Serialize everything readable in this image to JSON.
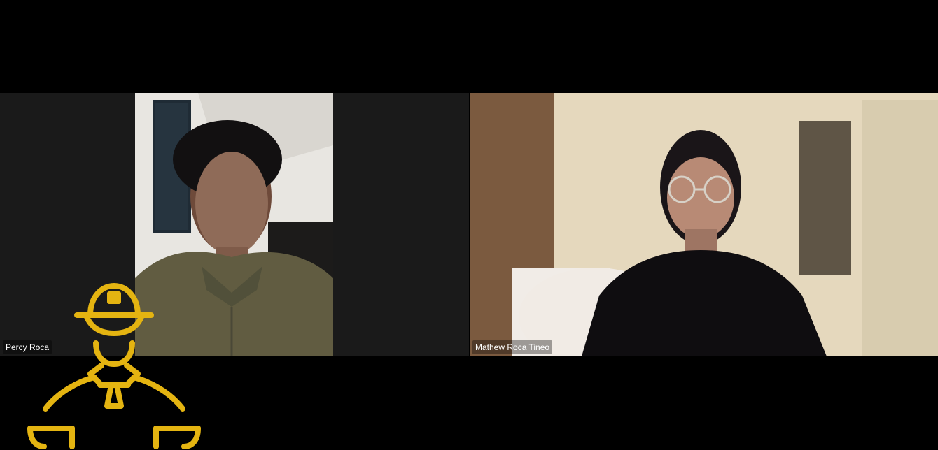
{
  "participants": [
    {
      "name": "Percy Roca"
    },
    {
      "name": "Mathew Roca Tineo"
    }
  ],
  "colors": {
    "background": "#000000",
    "tile": "#1a1a1a",
    "logo": "#e4b411"
  },
  "icons": {
    "logo": "construction-worker-logo-icon"
  }
}
